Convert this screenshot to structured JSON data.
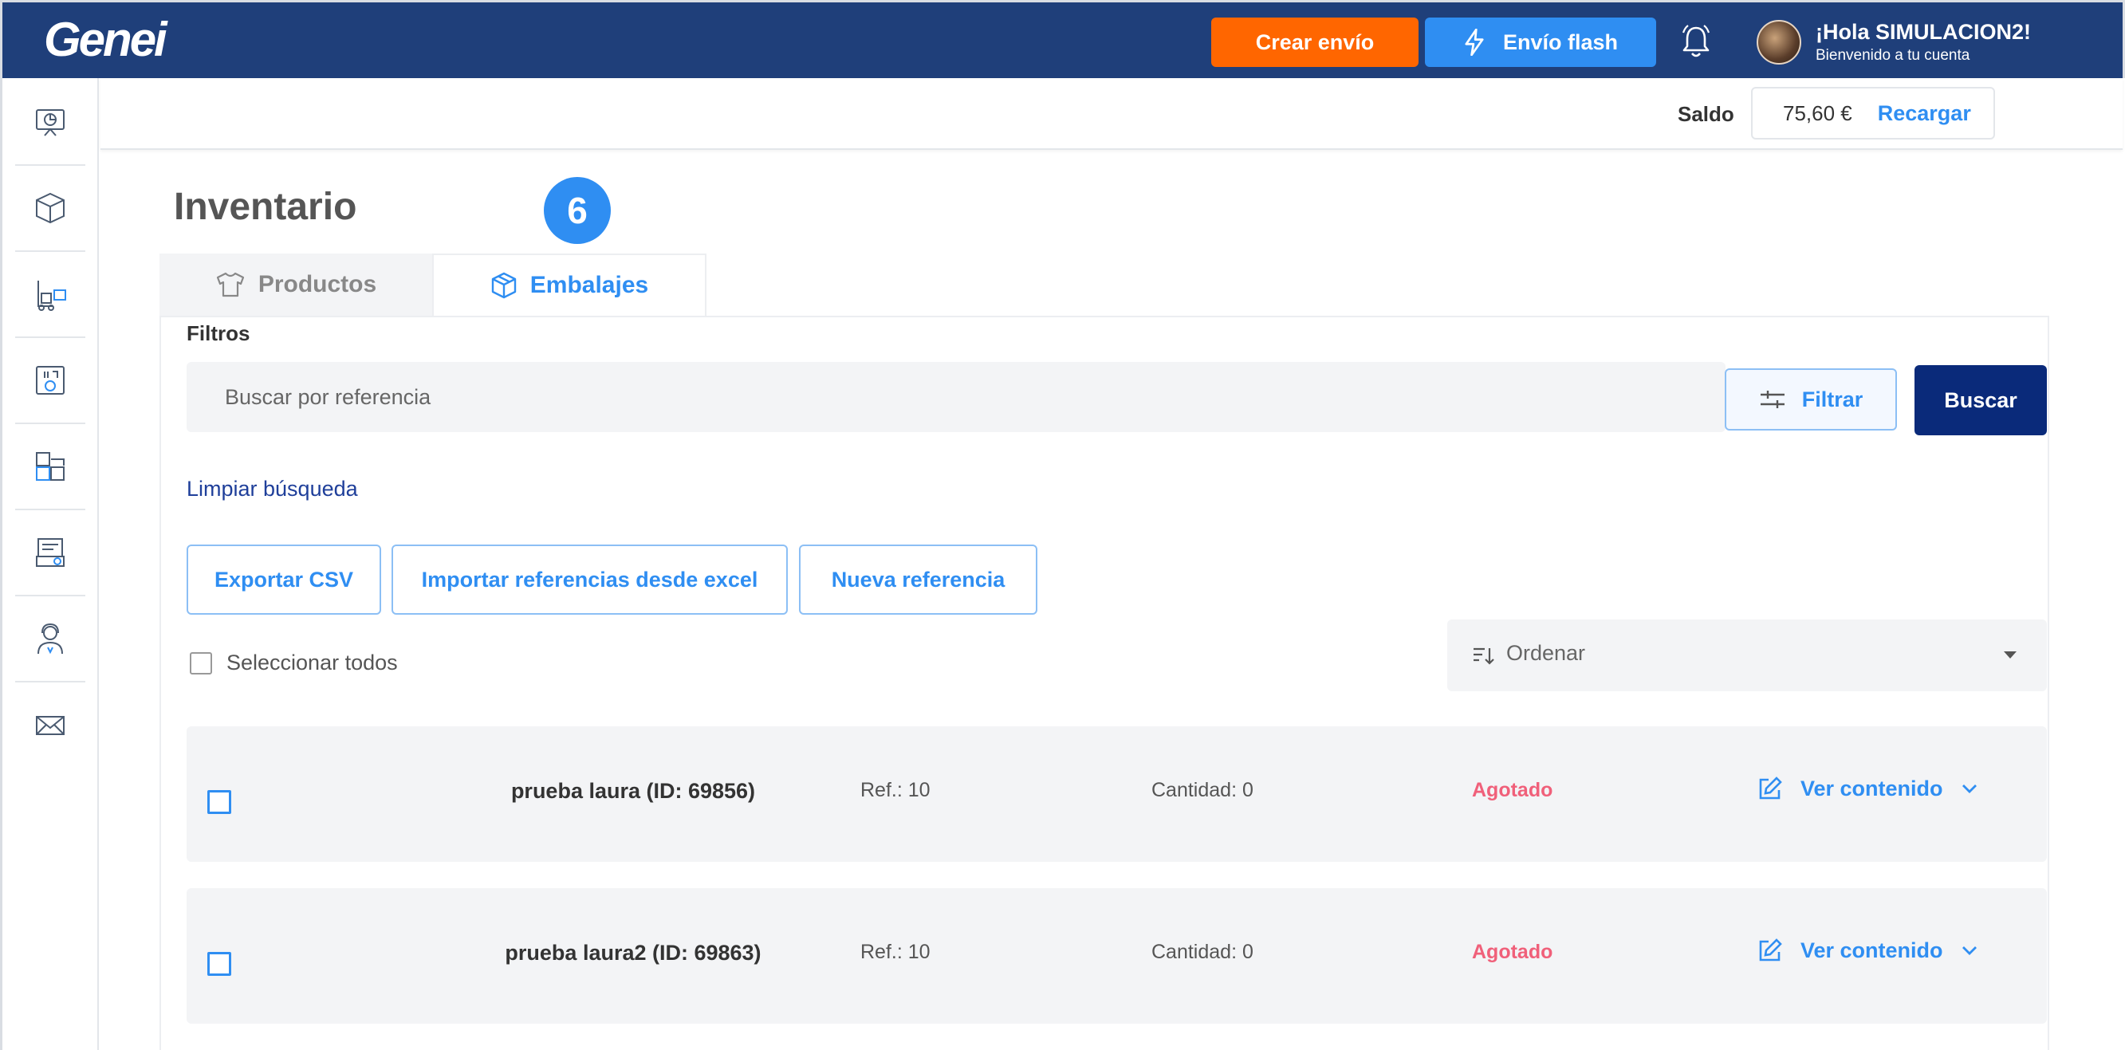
{
  "header": {
    "logo": "Genei",
    "crear_envio": "Crear envío",
    "envio_flash": "Envío flash",
    "greeting": "¡Hola SIMULACION2!",
    "welcome": "Bienvenido a tu cuenta"
  },
  "sidebar": {
    "icons": [
      "dashboard-icon",
      "package-icon",
      "warehouse-forklift-icon",
      "returns-icon",
      "puzzle-icon",
      "invoice-icon",
      "support-agent-icon",
      "mail-icon"
    ]
  },
  "balance": {
    "label": "Saldo",
    "value": "75,60 €",
    "recargar": "Recargar"
  },
  "page": {
    "title": "Inventario",
    "badge": "6"
  },
  "tabs": [
    {
      "label": "Productos",
      "icon": "tshirt-icon",
      "active": false
    },
    {
      "label": "Embalajes",
      "icon": "box-icon",
      "active": true
    }
  ],
  "filters": {
    "heading": "Filtros",
    "search_placeholder": "Buscar por referencia",
    "filtrar": "Filtrar",
    "buscar": "Buscar",
    "limpiar": "Limpiar búsqueda"
  },
  "actions": {
    "export_csv": "Exportar CSV",
    "import_excel": "Importar referencias desde excel",
    "nueva_referencia": "Nueva referencia"
  },
  "list": {
    "select_all": "Seleccionar todos",
    "sort_label": "Ordenar",
    "rows": [
      {
        "name": "prueba laura (ID: 69856)",
        "ref": "Ref.: 10",
        "quantity": "Cantidad: 0",
        "status": "Agotado",
        "action": "Ver contenido"
      },
      {
        "name": "prueba laura2 (ID: 69863)",
        "ref": "Ref.: 10",
        "quantity": "Cantidad: 0",
        "status": "Agotado",
        "action": "Ver contenido"
      }
    ]
  },
  "colors": {
    "topbar": "#1f3f7a",
    "orange": "#ff6600",
    "blue": "#2f8ef2",
    "navy": "#0a2a7a",
    "status_red": "#f0607a"
  }
}
